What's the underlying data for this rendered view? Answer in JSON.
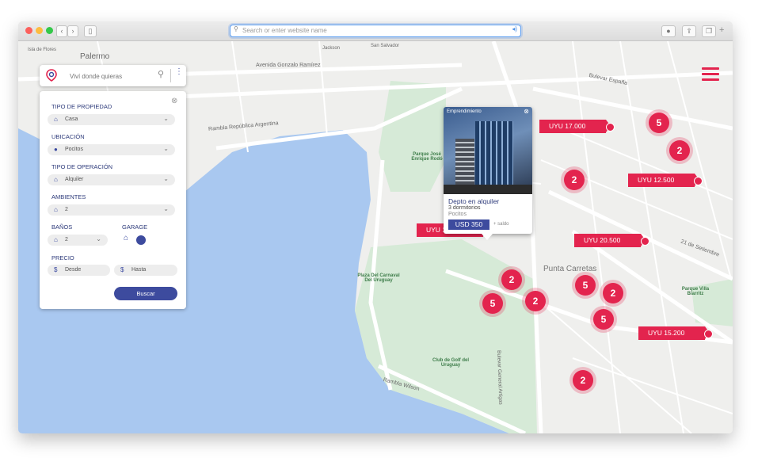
{
  "browser": {
    "url_placeholder": "Search or enter website name"
  },
  "search": {
    "placeholder": "Viví donde quieras"
  },
  "filters": {
    "property_type": {
      "label": "TIPO DE PROPIEDAD",
      "value": "Casa"
    },
    "location": {
      "label": "UBICACIÓN",
      "value": "Pocitos"
    },
    "operation": {
      "label": "TIPO DE OPERACIÓN",
      "value": "Alquiler"
    },
    "rooms": {
      "label": "AMBIENTES",
      "value": "2"
    },
    "baths": {
      "label": "BAÑOS",
      "value": "2"
    },
    "garage": {
      "label": "GARAGE"
    },
    "price": {
      "label": "PRECIO",
      "from_placeholder": "Desde",
      "to_placeholder": "Hasta"
    },
    "search_button": "Buscar"
  },
  "card": {
    "tag": "Emprendimiento",
    "title": "Depto en alquiler",
    "rooms": "3 dormitorios",
    "location": "Pocitos",
    "price": "USD 350",
    "extra": "+ saldo"
  },
  "prices": [
    "UYU 17.000",
    "UYU 12.500",
    "UYU 13.500",
    "UYU 20.500",
    "UYU 15.200"
  ],
  "clusters": [
    "5",
    "2",
    "2",
    "2",
    "5",
    "2",
    "5",
    "2",
    "5",
    "2"
  ],
  "map_labels": {
    "palermo": "Palermo",
    "punta_carretas": "Punta Carretas",
    "parque_rodo": "Parque José Enrique Rodó",
    "plaza_carnaval": "Plaza Del Carnaval Del Uruguay",
    "club_golf": "Club de Golf del Uruguay",
    "rambla_wilson": "Rambla Wilson",
    "rambla_argentina": "Rambla República Argentina",
    "bulevar_espana": "Bulevar España",
    "bulevar_artigas": "Bulevar General Artigas",
    "av_gonzalo_ramirez": "Avenida Gonzalo Ramírez",
    "calle_21_setiembre": "21 de Setiembre",
    "parque_villa_biarritz": "Parque Villa Biarritz",
    "isla_de_flores": "Isla de Flores",
    "san_salvador": "San Salvador",
    "jackson": "Jackson"
  },
  "colors": {
    "accent": "#e3244e",
    "brand": "#3d4b9e",
    "water": "#a9c8f0",
    "park": "#d6ead7"
  }
}
